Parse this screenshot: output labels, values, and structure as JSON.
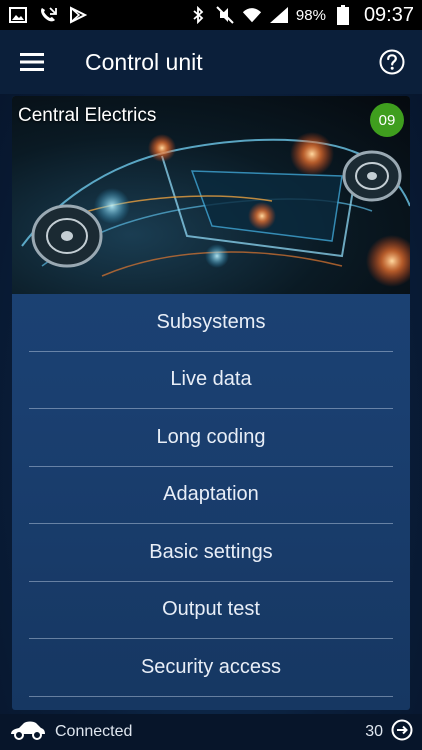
{
  "status_bar": {
    "left_icons": [
      "gallery-icon",
      "missed-call-icon",
      "play-store-icon"
    ],
    "right_icons": [
      "bluetooth-icon",
      "mute-icon",
      "wifi-icon",
      "signal-icon",
      "battery-icon"
    ],
    "battery_percent": "98%",
    "time": "09:37"
  },
  "app_bar": {
    "title": "Control unit",
    "menu_icon": "hamburger-icon",
    "help_icon": "help-icon"
  },
  "card": {
    "title": "Central Electrics",
    "badge": "09",
    "badge_color": "#3f9e1e"
  },
  "menu": {
    "items": [
      {
        "label": "Subsystems"
      },
      {
        "label": "Live data"
      },
      {
        "label": "Long coding"
      },
      {
        "label": "Adaptation"
      },
      {
        "label": "Basic settings"
      },
      {
        "label": "Output test"
      },
      {
        "label": "Security access"
      }
    ]
  },
  "bottom_bar": {
    "connection_icon": "car-icon",
    "connection_status": "Connected",
    "count": "30",
    "exit_icon": "exit-icon"
  }
}
